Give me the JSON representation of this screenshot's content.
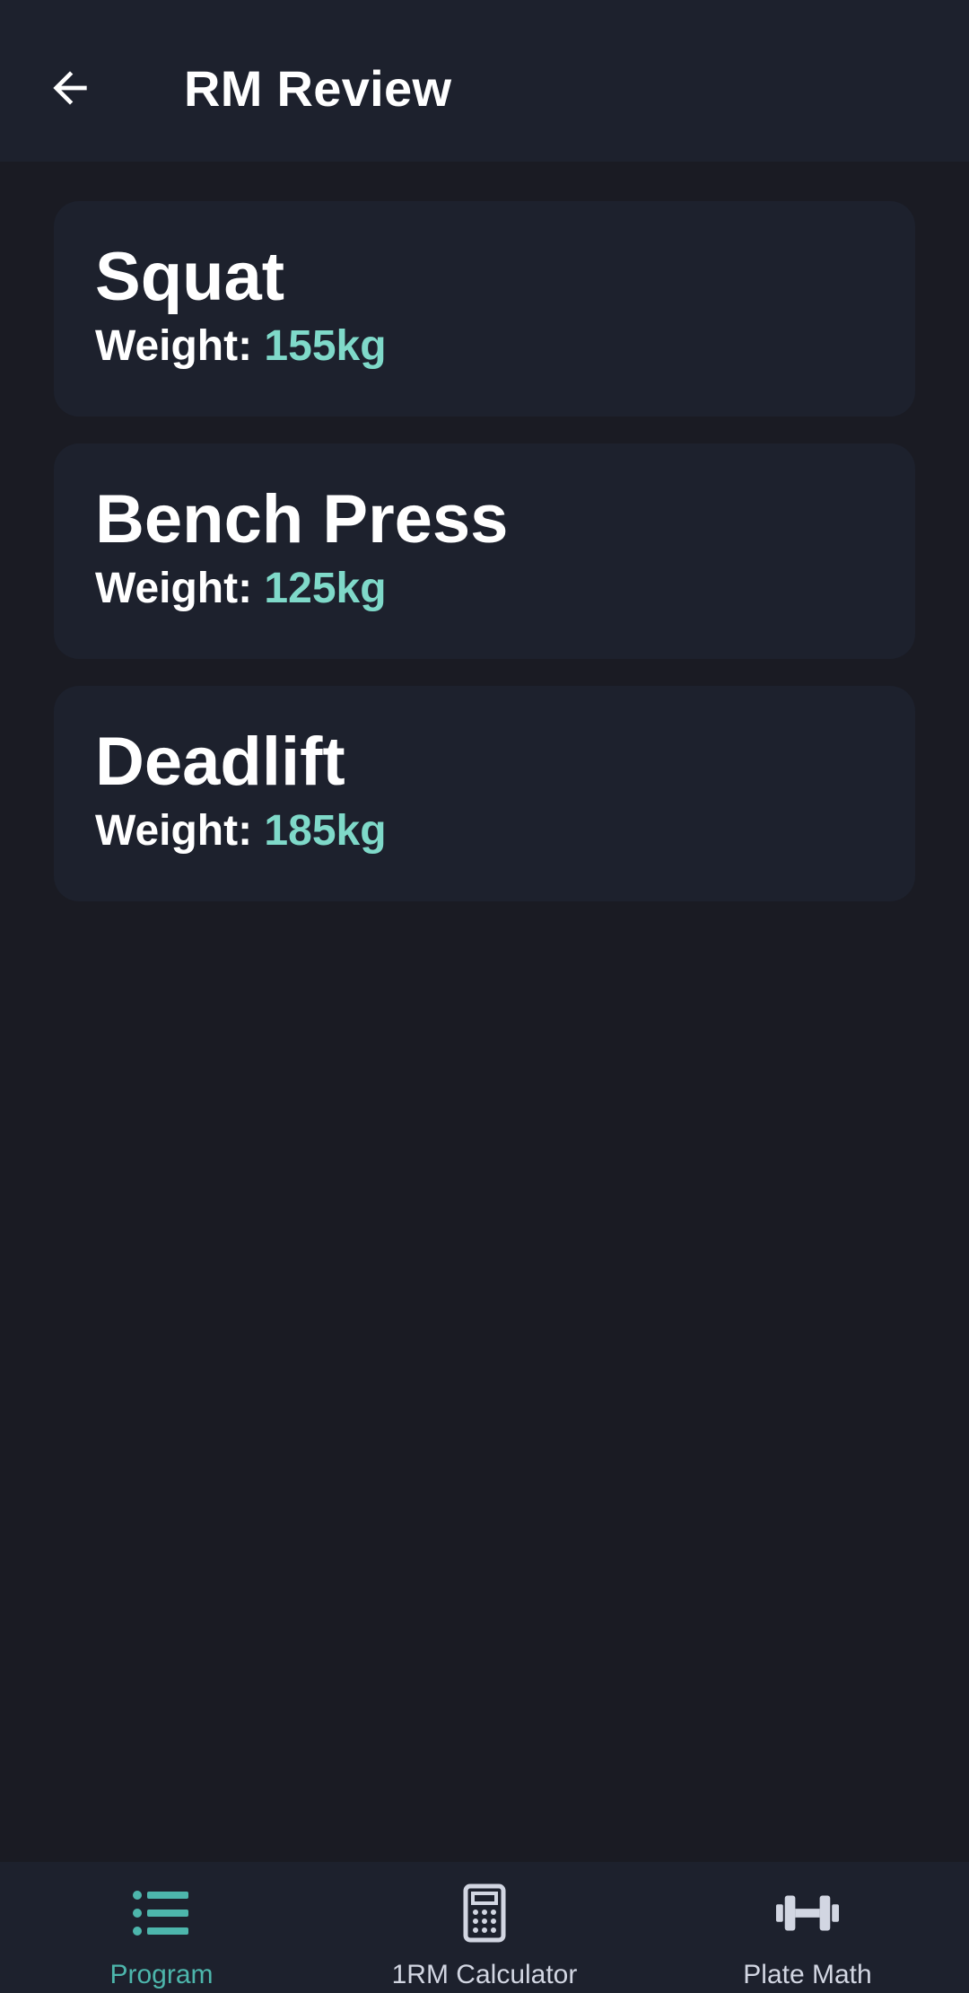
{
  "header": {
    "title": "RM Review"
  },
  "lifts": [
    {
      "name": "Squat",
      "weight_label": "Weight:",
      "weight_value": "155kg"
    },
    {
      "name": "Bench Press",
      "weight_label": "Weight:",
      "weight_value": "125kg"
    },
    {
      "name": "Deadlift",
      "weight_label": "Weight:",
      "weight_value": "185kg"
    }
  ],
  "bottom_nav": {
    "items": [
      {
        "label": "Program",
        "icon": "list-icon",
        "active": true
      },
      {
        "label": "1RM Calculator",
        "icon": "calculator-icon",
        "active": false
      },
      {
        "label": "Plate Math",
        "icon": "dumbbell-icon",
        "active": false
      }
    ]
  },
  "colors": {
    "background": "#1a1b23",
    "surface": "#1d212d",
    "accent": "#4db6ac",
    "weight_value": "#7fd9c9",
    "inactive_icon": "#d2d6e2"
  }
}
